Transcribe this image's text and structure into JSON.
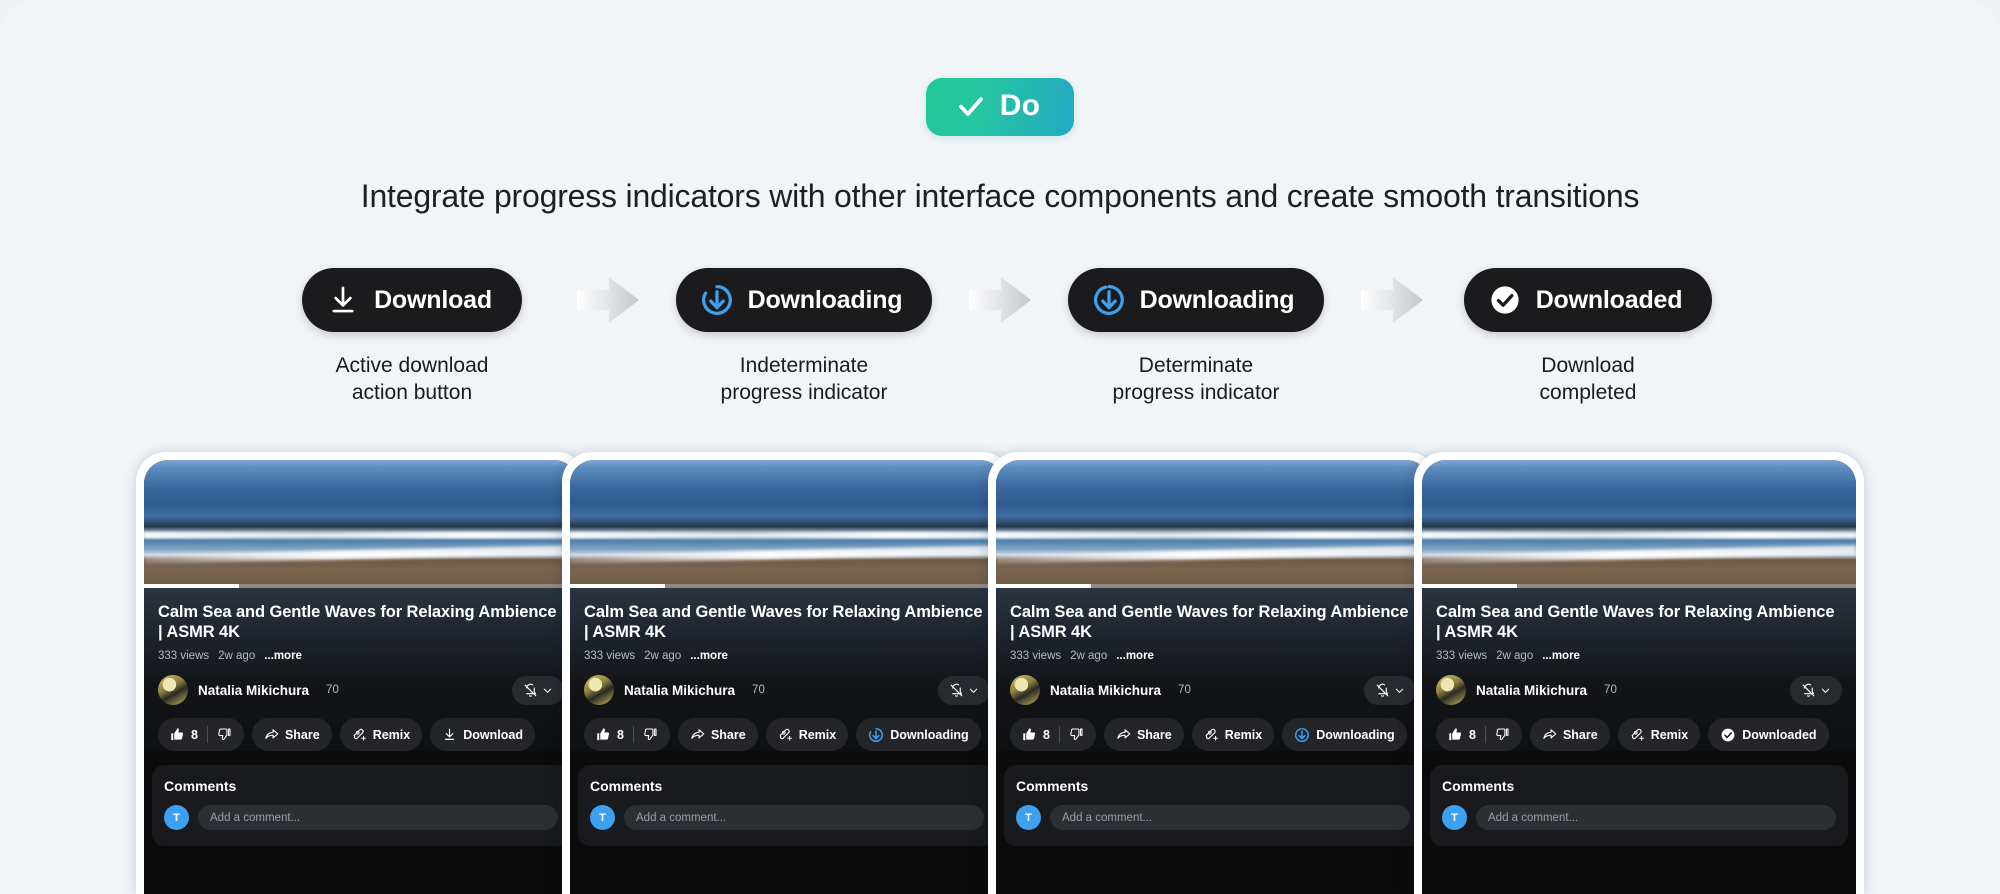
{
  "badge": {
    "label": "Do",
    "icon": "check-icon",
    "gradient_from": "#24c79a",
    "gradient_to": "#21a9c4"
  },
  "subtitle": "Integrate progress indicators with other interface components and create smooth transitions",
  "steps": [
    {
      "label": "Download",
      "icon": "download-arrow-icon",
      "caption": "Active download\naction button"
    },
    {
      "label": "Downloading",
      "icon": "indeterminate-spinner-icon",
      "caption": "Indeterminate\nprogress indicator"
    },
    {
      "label": "Downloading",
      "icon": "determinate-progress-icon",
      "caption": "Determinate\nprogress indicator"
    },
    {
      "label": "Downloaded",
      "icon": "check-circle-icon",
      "caption": "Download\ncompleted"
    }
  ],
  "arrow_icon": "arrow-right-icon",
  "accent_blue": "#3ea0f0",
  "video": {
    "title": "Calm Sea and Gentle Waves for Relaxing Ambience | ASMR 4K",
    "views": "333 views",
    "age": "2w ago",
    "more": "...more",
    "progress_percent": 22
  },
  "channel": {
    "name": "Natalia Mikichura",
    "subscribers": "70",
    "bell_icon": "bell-off-icon",
    "chevron_icon": "chevron-down-icon"
  },
  "chips": {
    "like_count": "8",
    "like_icon": "thumbs-up-icon",
    "dislike_icon": "thumbs-down-icon",
    "share_label": "Share",
    "share_icon": "share-arrow-icon",
    "remix_label": "Remix",
    "remix_icon": "remix-icon"
  },
  "comments": {
    "title": "Comments",
    "avatar_initial": "T",
    "placeholder": "Add a comment..."
  },
  "cards": [
    {
      "download_chip_label": "Download",
      "download_chip_icon": "download-arrow-icon"
    },
    {
      "download_chip_label": "Downloading",
      "download_chip_icon": "indeterminate-spinner-icon"
    },
    {
      "download_chip_label": "Downloading",
      "download_chip_icon": "determinate-progress-icon"
    },
    {
      "download_chip_label": "Downloaded",
      "download_chip_icon": "check-circle-icon"
    }
  ]
}
